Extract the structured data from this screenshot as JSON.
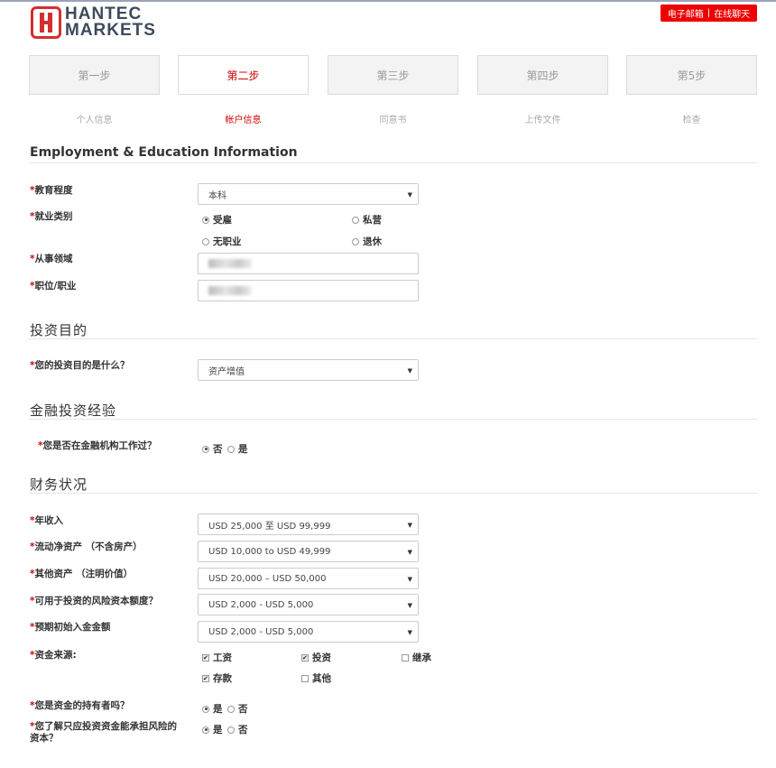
{
  "header": {
    "logo_line1": "HANTEC",
    "logo_line2": "MARKETS",
    "email_link": "电子邮箱",
    "separator": "|",
    "chat_link": "在线聊天"
  },
  "steps": [
    {
      "label": "第一步",
      "caption": "个人信息",
      "active": false
    },
    {
      "label": "第二步",
      "caption": "帐户信息",
      "active": true
    },
    {
      "label": "第三步",
      "caption": "同意书",
      "active": false
    },
    {
      "label": "第四步",
      "caption": "上传文件",
      "active": false
    },
    {
      "label": "第5步",
      "caption": "检查",
      "active": false
    }
  ],
  "employment": {
    "title": "Employment & Education Information",
    "education_label": "教育程度",
    "education_value": "本科",
    "employment_label": "就业类别",
    "employment_options": [
      "受雇",
      "私营",
      "无职业",
      "退休"
    ],
    "employment_selected": "受雇",
    "field_label": "从事领域",
    "position_label": "职位/职业"
  },
  "purpose": {
    "title": "投资目的",
    "question": "您的投资目的是什么？",
    "value": "资产增值"
  },
  "experience": {
    "title": "金融投资经验",
    "question": "您是否在金融机构工作过？",
    "options": [
      "否",
      "是"
    ],
    "selected": "否"
  },
  "financial": {
    "title": "财务状况",
    "annual_income_label": "年收入",
    "annual_income_value": "USD 25,000 至 USD 99,999",
    "liquid_assets_label": "流动净资产 （不含房产）",
    "liquid_assets_value": "USD 10,000 to USD 49,999",
    "other_assets_label": "其他资产 （注明价值）",
    "other_assets_value": "USD 20,000 – USD 50,000",
    "risk_capital_label": "可用于投资的风险资本额度？",
    "risk_capital_value": "USD 2,000 - USD 5,000",
    "initial_deposit_label": "预期初始入金金额",
    "initial_deposit_value": "USD 2,000 - USD 5,000",
    "source_label": "资金来源:",
    "sources": [
      {
        "label": "工资",
        "checked": true
      },
      {
        "label": "投资",
        "checked": true
      },
      {
        "label": "继承",
        "checked": false
      },
      {
        "label": "存款",
        "checked": true
      },
      {
        "label": "其他",
        "checked": false
      }
    ],
    "holder_question": "您是资金的持有者吗？",
    "holder_options": [
      "是",
      "否"
    ],
    "holder_selected": "是",
    "risk_question_line1": "您了解只应投资资金能承担风险的",
    "risk_question_line2": "资本？",
    "risk_options": [
      "是",
      "否"
    ],
    "risk_selected": "是"
  },
  "required_mark": "*",
  "colors": {
    "accent": "#d40000",
    "button_red": "#ee0000"
  },
  "icons": {
    "dropdown": "caret-down-icon",
    "radio": "radio-icon",
    "checkbox": "checkbox-icon"
  }
}
